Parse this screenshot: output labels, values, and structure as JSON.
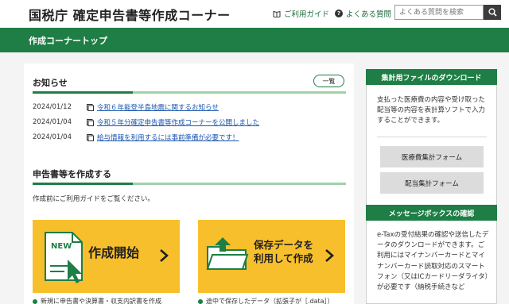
{
  "header": {
    "title": "国税庁 確定申告書等作成コーナー",
    "guide_link": "ご利用ガイド",
    "faq_link": "よくある質問",
    "search_placeholder": "よくある質問を検索"
  },
  "navbar": {
    "title": "作成コーナートップ"
  },
  "news": {
    "title": "お知らせ",
    "list_button": "一覧",
    "items": [
      {
        "date": "2024/01/12",
        "text": "令和６年能登半島地震に関するお知らせ"
      },
      {
        "date": "2024/01/04",
        "text": "令和５年分確定申告書等作成コーナーを公開しました"
      },
      {
        "date": "2024/01/04",
        "text": "給与情報を利用するには事前準備が必要です！"
      }
    ]
  },
  "create": {
    "title": "申告書等を作成する",
    "intro": "作成前にご利用ガイドをご覧ください。",
    "start_card": {
      "badge": "NEW",
      "label": "作成開始",
      "note": "新規に申告書や決算書・収支内訳書を作成"
    },
    "saved_card": {
      "label_line1": "保存データを",
      "label_line2": "利用して作成",
      "note": "途中で保存したデータ（拡張子が［.data］）"
    }
  },
  "sidebar": {
    "download": {
      "title": "集計用ファイルのダウンロード",
      "text": "支払った医療費の内容や受け取った配当等の内容を表計算ソフトで入力することができます。",
      "buttons": [
        "医療費集計フォーム",
        "配当集計フォーム"
      ]
    },
    "messagebox": {
      "title": "メッセージボックスの確認",
      "text": "e-Taxの受付結果の確認や送信したデータのダウンロードができます。ご利用にはマイナンバーカードとマイナンバーカード読取対応のスマートフォン（又はICカードリーダライタ）が必要です（納税手続きなど"
    }
  },
  "colors": {
    "brand_green": "#1e7e45",
    "card_yellow": "#f7bf2b",
    "link_blue": "#1a56b0"
  }
}
